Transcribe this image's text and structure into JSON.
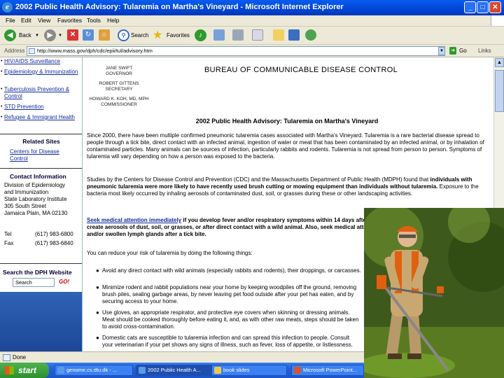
{
  "window": {
    "title": "2002 Public Health Advisory: Tularemia on Martha's Vineyard - Microsoft Internet Explorer",
    "min": "_",
    "max": "□",
    "close": "✕"
  },
  "menu": [
    "File",
    "Edit",
    "View",
    "Favorites",
    "Tools",
    "Help"
  ],
  "toolbar": {
    "back": "Back",
    "search": "Search",
    "favorites": "Favorites"
  },
  "address": {
    "label": "Address",
    "url": "http://www.mass.gov/dph/cdc/epii/tul/advisory.htm",
    "go": "Go",
    "links": "Links"
  },
  "sidebar": {
    "nav_items": [
      "HIV/AIDS Surveillance",
      "Epidemiology & Immunization",
      "Tuberculosis Prevention & Control",
      "STD Prevention",
      "Refugee & Immigrant Health"
    ],
    "related_title": "Related Sites",
    "related_link": "Centers for Disease Control",
    "contact_title": "Contact Information",
    "contact_lines": [
      "Division of Epidemiology",
      "and Immunization",
      "State Laboratory Institute",
      "305 South Street",
      "Jamaica Plain, MA 02130"
    ],
    "tel_label": "Tel",
    "tel": "(617) 983-6800",
    "fax_label": "Fax",
    "fax": "(617) 983-6840",
    "search_title": "Search the DPH Website",
    "search_placeholder": "Search",
    "search_go": "GO!"
  },
  "header": {
    "officials": [
      [
        "JANE SWIFT",
        "GOVERNOR"
      ],
      [
        "ROBERT GITTENS",
        "SECRETARY"
      ],
      [
        "HOWARD K. KOH, MD, MPH",
        "COMMISSIONER"
      ]
    ],
    "bureau": "BUREAU OF COMMUNICABLE DISEASE CONTROL"
  },
  "article": {
    "title": "2002 Public Health Advisory: Tularemia on Martha's Vineyard",
    "p1": "Since 2000, there have been multiple confirmed pneumonic tularemia cases associated with Martha's Vineyard. Tularemia is a rare bacterial disease spread to people through a tick bite, direct contact with an infected animal, ingestion of water or meat that has been contaminated by an infected animal, or by inhalation of contaminated particles. Many animals can be sources of infection, particularly rabbits and rodents. Tularemia is not spread from person to person. Symptoms of tularemia will vary depending on how a person was exposed to the bacteria.",
    "p2_normal": "Studies by the Centers for Disease Control and Prevention (CDC) and the Massachusetts Department of Public Health (MDPH) found that ",
    "p2_bold": "individuals with pneumonic tularemia were more likely to have recently used brush cutting or mowing equipment than individuals without tularemia.",
    "p2_tail": " Exposure to the bacteria most likely occurred by inhaling aerosols of contaminated dust, soil, or grasses during these or other landscaping activities.",
    "p3_link": "Seek medical attention immediately",
    "p3_bold": " if you develop fever and/or respiratory symptoms within 14 days after landscaping, or other activities that may create aerosols of dust, soil, or grasses, or after direct contact with a wild animal. Also, seek medical attention if you develop a fever and/or skin sore and/or swollen lymph glands after a tick bite.",
    "p4": "You can reduce your risk of tularemia by doing the following things:",
    "bullets": [
      "Avoid any direct contact with wild animals (especially rabbits and rodents), their droppings, or carcasses.",
      "Minimize rodent and rabbit populations near your home by keeping woodpiles off the ground, removing brush piles, sealing garbage areas, by never leaving pet food outside after your pet has eaten, and by securing access to your home.",
      "Use gloves, an appropriate respirator, and protective eye covers when skinning or dressing animals. Meat should be cooked thoroughly before eating it, and, as with other raw meats, steps should be taken to avoid cross-contamination.",
      "Domestic cats are susceptible to tularemia infection and can spread this infection to people. Consult your veterinarian if your pet shows any signs of illness, such as fever, loss of appetite, or listlessness."
    ]
  },
  "status": {
    "text": "Done"
  },
  "taskbar": {
    "start": "start",
    "tasks": [
      "genome.cs.dtu.dk - ...",
      "2002 Public Health A...",
      "book slides",
      "Microsoft PowerPoint..."
    ]
  },
  "icons": {
    "ie": "ie-icon",
    "back": "back-arrow-icon",
    "forward": "forward-arrow-icon",
    "stop": "stop-icon",
    "refresh": "refresh-icon",
    "home": "home-icon",
    "search": "search-icon",
    "favorites": "star-icon",
    "media": "media-icon",
    "mail": "mail-icon",
    "print": "print-icon",
    "edit": "edit-icon",
    "messenger": "messenger-icon"
  }
}
